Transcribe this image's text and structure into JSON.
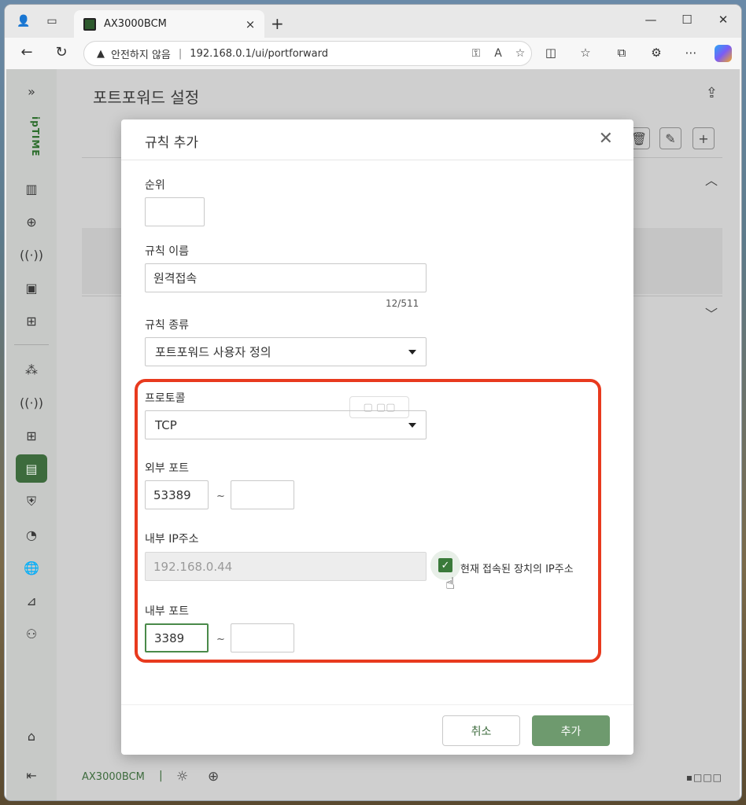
{
  "browser": {
    "tab_title": "AX3000BCM",
    "tab_close": "×",
    "new_tab": "+",
    "minimize": "—",
    "maximize": "☐",
    "close": "✕",
    "security_label": "안전하지 않음",
    "url": "192.168.0.1/ui/portforward",
    "separator": "|"
  },
  "page": {
    "title": "포트포워드 설정",
    "brand": "AX3000BCM",
    "footer_sep": "|",
    "logo": "ipTIME"
  },
  "modal": {
    "title": "규칙 추가",
    "close": "✕",
    "priority": {
      "label": "순위",
      "value": ""
    },
    "rule_name": {
      "label": "규칙 이름",
      "value": "원격접속",
      "counter": "12/511"
    },
    "rule_type": {
      "label": "규칙 종류",
      "value": "포트포워드 사용자 정의"
    },
    "protocol": {
      "label": "프로토콜",
      "value": "TCP"
    },
    "external_port": {
      "label": "외부 포트",
      "from": "53389",
      "to": "",
      "tilde": "~"
    },
    "internal_ip": {
      "label": "내부 IP주소",
      "value": "192.168.0.44",
      "checkbox_label": "현재 접속된 장치의 IP주소",
      "checked": true
    },
    "internal_port": {
      "label": "내부 포트",
      "from": "3389",
      "to": "",
      "tilde": "~"
    },
    "cancel_label": "취소",
    "add_label": "추가"
  },
  "colors": {
    "accent_green": "#3d6b3d",
    "highlight_red": "#e83a1e",
    "add_button": "#6e9a6e"
  },
  "icons": [
    "search-icon",
    "warning-icon",
    "close-icon",
    "caret-down-icon",
    "check-icon",
    "share-icon"
  ]
}
